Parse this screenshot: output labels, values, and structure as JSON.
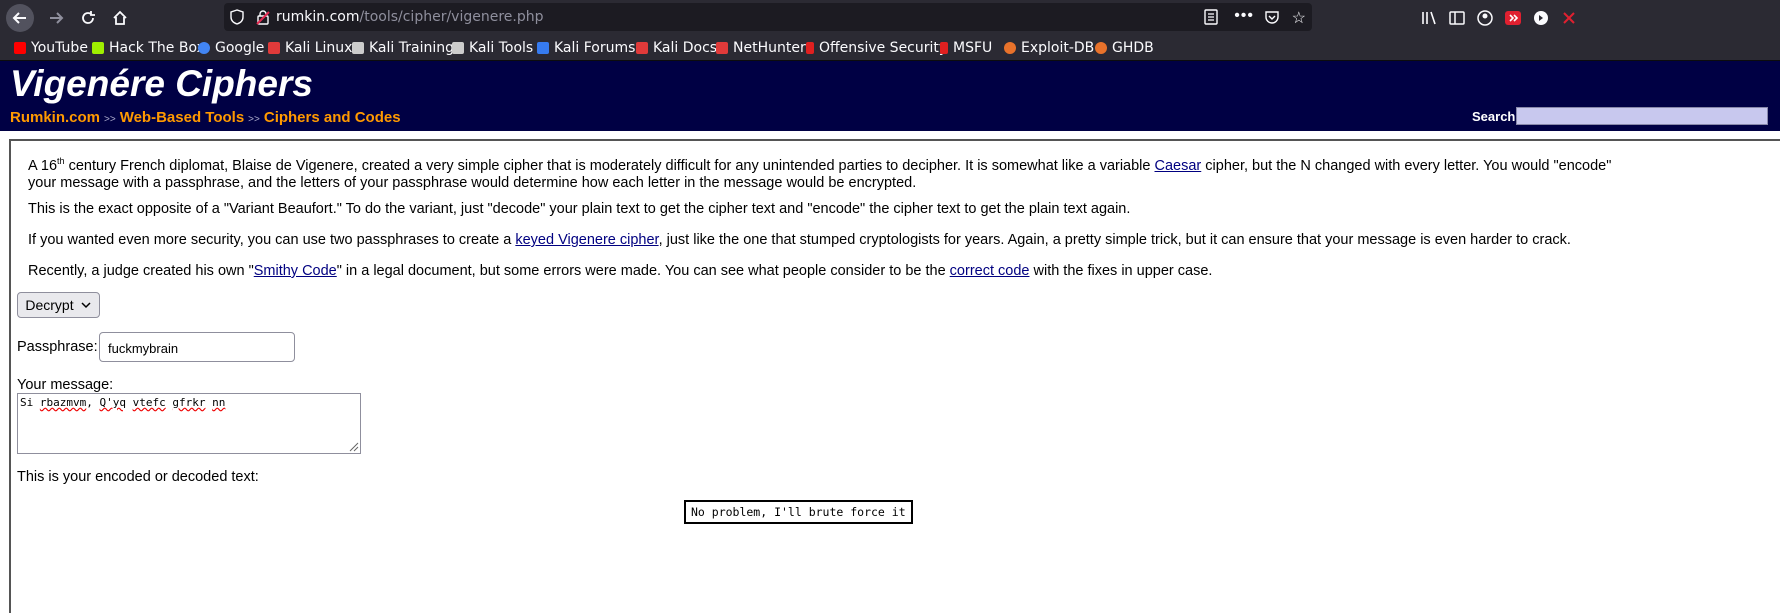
{
  "browser": {
    "url_host": "rumkin.com",
    "url_path": "/tools/cipher/vigenere.php",
    "bookmarks": [
      {
        "label": "YouTube",
        "icon": "youtube-icon",
        "color": "#ff0000"
      },
      {
        "label": "Hack The Box",
        "icon": "htb-icon",
        "color": "#9fef00"
      },
      {
        "label": "Google",
        "icon": "google-icon",
        "color": "#4285f4"
      },
      {
        "label": "Kali Linux",
        "icon": "kali-icon",
        "color": "#e03a3a"
      },
      {
        "label": "Kali Training",
        "icon": "kali-dragon-icon",
        "color": "#cccccc"
      },
      {
        "label": "Kali Tools",
        "icon": "kali-dragon-icon",
        "color": "#cccccc"
      },
      {
        "label": "Kali Forums",
        "icon": "kali-forums-icon",
        "color": "#367bf0"
      },
      {
        "label": "Kali Docs",
        "icon": "kali-docs-icon",
        "color": "#e03a3a"
      },
      {
        "label": "NetHunter",
        "icon": "kali-icon",
        "color": "#e03a3a"
      },
      {
        "label": "Offensive Security",
        "icon": "offsec-icon",
        "color": "#e02020"
      },
      {
        "label": "MSFU",
        "icon": "offsec-icon",
        "color": "#e02020"
      },
      {
        "label": "Exploit-DB",
        "icon": "exploitdb-icon",
        "color": "#e8722b"
      },
      {
        "label": "GHDB",
        "icon": "exploitdb-icon",
        "color": "#e8722b"
      }
    ]
  },
  "header": {
    "title": "Vigenére Ciphers",
    "crumbs": [
      "Rumkin.com",
      "Web-Based Tools",
      "Ciphers and Codes"
    ],
    "crumb_sep": ">>",
    "search_label": "Search:"
  },
  "content": {
    "p1_a": "A 16",
    "p1_sup": "th",
    "p1_b": " century French diplomat, Blaise de Vigenere, created a very simple cipher that is moderately difficult for any unintended parties to decipher. It is somewhat like a variable ",
    "p1_link": "Caesar",
    "p1_c": " cipher, but the N changed with every letter. You would \"encode\"",
    "p1_line2": "your message with a passphrase, and the letters of your passphrase would determine how each letter in the message would be encrypted.",
    "p2": "This is the exact opposite of a \"Variant Beaufort.\" To do the variant, just \"decode\" your plain text to get the cipher text and \"encode\" the cipher text to get the plain text again.",
    "p3_a": "If you wanted even more security, you can use two passphrases to create a ",
    "p3_link": "keyed Vigenere cipher",
    "p3_b": ", just like the one that stumped cryptologists for years. Again, a pretty simple trick, but it can ensure that your message is even harder to crack.",
    "p4_a": "Recently, a judge created his own \"",
    "p4_link1": "Smithy Code",
    "p4_b": "\" in a legal document, but some errors were made. You can see what people consider to be the ",
    "p4_link2": "correct code",
    "p4_c": " with the fixes in upper case."
  },
  "form": {
    "mode": "Decrypt",
    "passphrase_label": "Passphrase:",
    "passphrase_value": "fuckmybrain",
    "message_label": "Your message:",
    "message_words": [
      "Si",
      " ",
      "rbazmvm",
      ", ",
      "Q'yq",
      " ",
      "vtefc",
      " ",
      "gfrkr",
      " ",
      "nn"
    ],
    "result_label": "This is your encoded or decoded text:",
    "result_value": "No problem, I'll brute force it"
  },
  "colors": {
    "header_bg": "#000044",
    "crumb": "#ff9900",
    "link": "#000080"
  }
}
